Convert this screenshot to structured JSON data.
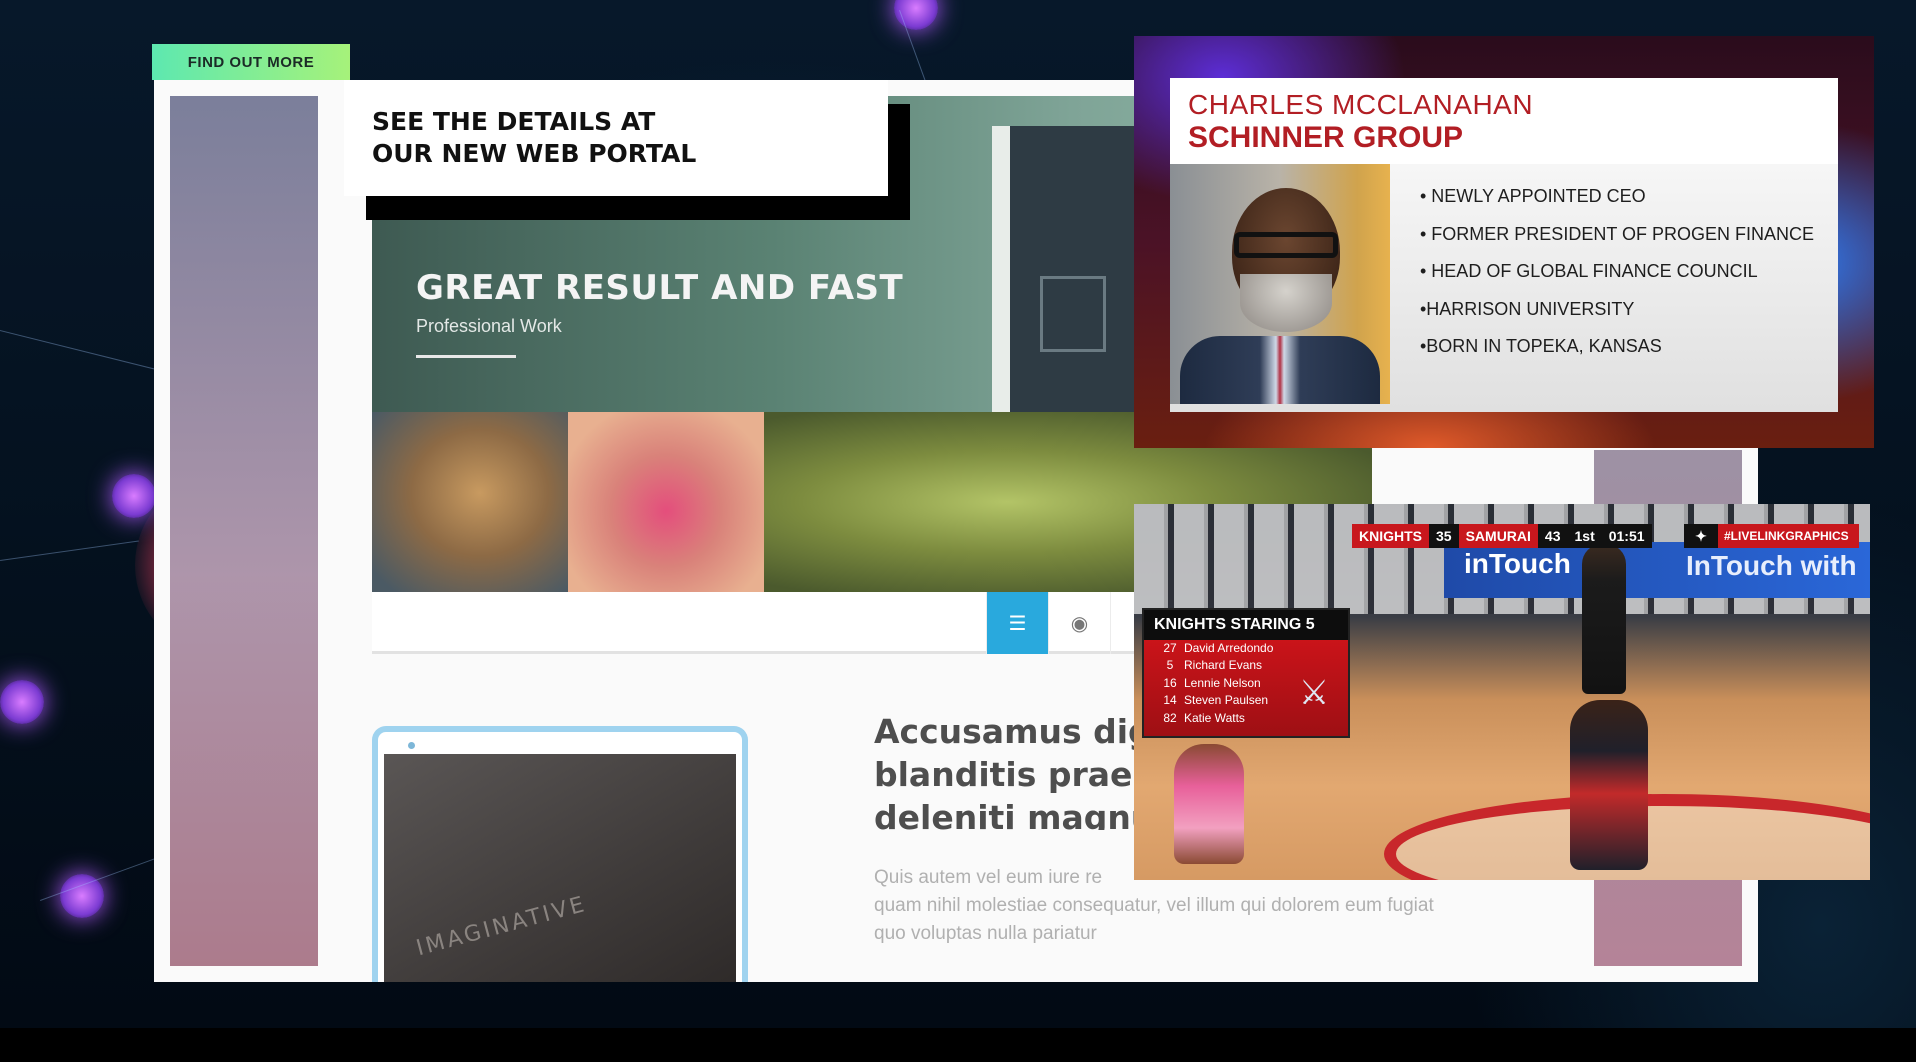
{
  "portal": {
    "find_out_more": "FIND OUT MORE",
    "callout_line_1": "SEE THE DETAILS AT",
    "callout_line_2": "OUR NEW WEB PORTAL",
    "hero_title": "GREAT RESULT AND FAST",
    "hero_subtitle": "Professional Work",
    "laptop_text": "IMAGINATIVE",
    "article_heading": "Accusamus dig\nblanditis praes\ndeleniti magnu",
    "article_body": "Quis autem vel eum iure re\nquam nihil molestiae consequatur, vel illum qui dolorem eum fugiat\nquo voluptas nulla pariatur",
    "toolbar_icons": [
      "sliders-icon",
      "eye-icon",
      "flame-icon",
      "wrench-icon"
    ]
  },
  "lower_third": {
    "name": "CHARLES MCCLANAHAN",
    "organization": "SCHINNER GROUP",
    "bullets": [
      "• NEWLY APPOINTED CEO",
      "• FORMER PRESIDENT OF PROGEN FINANCE",
      "• HEAD OF GLOBAL FINANCE COUNCIL",
      "•HARRISON UNIVERSITY",
      "•BORN IN TOPEKA, KANSAS"
    ],
    "accent_color": "#b21e24"
  },
  "broadcast": {
    "ad_text_1": "inTouch",
    "ad_text_2": "InTouch with",
    "scorebug": {
      "team_1": "KNIGHTS",
      "score_1": "35",
      "team_2": "SAMURAI",
      "score_2": "43",
      "period": "1st",
      "clock": "01:51"
    },
    "hashtag": "#LIVELINKGRAPHICS",
    "roster": {
      "title": "KNIGHTS STARING 5",
      "players": [
        {
          "number": "27",
          "name": "David Arredondo"
        },
        {
          "number": "5",
          "name": "Richard Evans"
        },
        {
          "number": "16",
          "name": "Lennie Nelson"
        },
        {
          "number": "14",
          "name": "Steven Paulsen"
        },
        {
          "number": "82",
          "name": "Katie Watts"
        }
      ]
    }
  }
}
